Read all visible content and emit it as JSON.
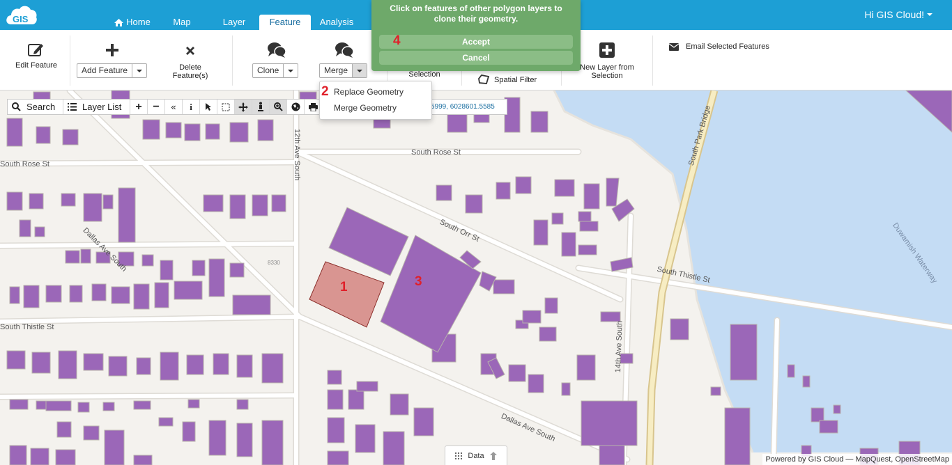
{
  "header": {
    "user_label": "Hi GIS Cloud!",
    "tabs": [
      {
        "label": "Home"
      },
      {
        "label": "Map"
      },
      {
        "label": "Layer"
      },
      {
        "label": "Feature"
      },
      {
        "label": "Analysis"
      }
    ],
    "active_tab": "Feature"
  },
  "ribbon": {
    "edit_feature": "Edit Feature",
    "add_feature": "Add Feature",
    "delete_line1": "Delete",
    "delete_line2": "Feature(s)",
    "clone": "Clone",
    "merge": "Merge",
    "selection": "Selection",
    "spatial_filter": "Spatial Filter",
    "new_layer_line1": "New Layer from",
    "new_layer_line2": "Selection",
    "email_selected": "Email Selected Features"
  },
  "merge_menu": {
    "items": [
      "Replace Geometry",
      "Merge Geometry"
    ]
  },
  "popup": {
    "message_line1": "Click on features of other polygon layers to",
    "message_line2": "clone their geometry.",
    "accept": "Accept",
    "cancel": "Cancel"
  },
  "map_toolbar": {
    "search": "Search",
    "layer_list": "Layer List",
    "coordinates": "5999, 6028601.5585"
  },
  "markers": {
    "m1": "1",
    "m2": "2",
    "m3": "3",
    "m4": "4"
  },
  "map_labels": {
    "dallas_ave_south_1": "Dallas Ave South",
    "dallas_ave_south_2": "Dallas Ave South",
    "twelfth_ave_south": "12th Ave South",
    "south_rose_st_1": "South Rose St",
    "south_rose_st_2": "South Rose St",
    "south_orr_st": "South Orr St",
    "south_thistle_st_1": "South Thistle St",
    "south_thistle_st_2": "South Thistle St",
    "fourteenth_ave_south": "14th Ave South",
    "south_park_bridge": "South Park Bridge",
    "duwamish_waterway": "Duwamish Waterway",
    "lot_8330": "8330"
  },
  "footer": {
    "attribution": "Powered by GIS Cloud — MapQuest, OpenStreetMap",
    "data_tab": "Data"
  },
  "colors": {
    "header_bg": "#1d9fd5",
    "popup_bg": "#6ea96a",
    "building": "#9b67b8",
    "selected_feature": "#d99591",
    "water": "#c4dcf4",
    "marker": "#e0202a"
  }
}
